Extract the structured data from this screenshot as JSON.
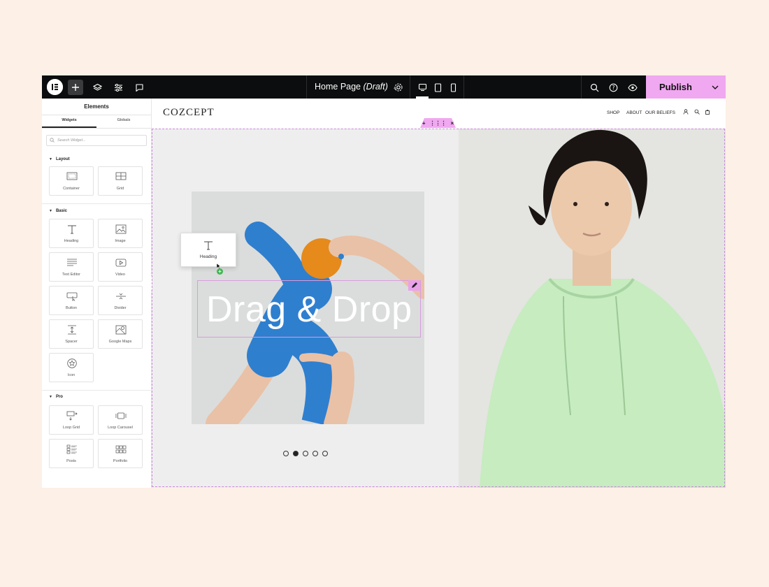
{
  "topbar": {
    "page_title": "Home Page",
    "page_status": "(Draft)",
    "publish_label": "Publish"
  },
  "panel": {
    "title": "Elements",
    "tabs": [
      "Widgets",
      "Globals"
    ],
    "search_placeholder": "Search Widget...",
    "categories": {
      "layout": {
        "label": "Layout",
        "items": [
          "Container",
          "Grid"
        ]
      },
      "basic": {
        "label": "Basic",
        "items": [
          "Heading",
          "Image",
          "Text Editor",
          "Video",
          "Button",
          "Divider",
          "Spacer",
          "Google Maps",
          "Icon"
        ]
      },
      "pro": {
        "label": "Pro",
        "items": [
          "Loop Grid",
          "Loop Carousel",
          "Posts",
          "Portfolio"
        ]
      }
    }
  },
  "site": {
    "brand": "COZCEPT",
    "nav": [
      "SHOP",
      "ABOUT",
      "OUR BELIEFS"
    ],
    "heading": "Drag & Drop",
    "drag_widget_label": "Heading",
    "slider_dots": 5,
    "active_dot": 2
  },
  "colors": {
    "accent": "#f0a8f0",
    "topbar": "#0c0d0e",
    "background": "#fdf0e6",
    "hoodie": "#c6ecc0",
    "sock": "#2f7fcf",
    "orange": "#e58a1b",
    "add_indicator": "#43b653"
  }
}
